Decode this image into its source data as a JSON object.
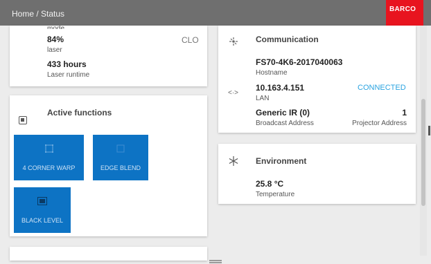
{
  "header": {
    "breadcrumb": "Home / Status",
    "brand": "BARCO",
    "brand_color": "#e8141f",
    "bar_color": "#6f6f6f"
  },
  "laser_card": {
    "value": "84%",
    "value_label": "laser",
    "runtime": "433 hours",
    "runtime_label": "Laser runtime",
    "mode_abbrev": "CLO"
  },
  "functions_card": {
    "title": "Active functions",
    "icon": "functions-icon",
    "tile_color": "#0d73c4",
    "tiles": [
      {
        "label": "4 CORNER WARP",
        "icon": "warp-icon"
      },
      {
        "label": "EDGE BLEND",
        "icon": "blend-icon"
      },
      {
        "label": "BLACK LEVEL",
        "icon": "black-level-icon"
      }
    ]
  },
  "communication_card": {
    "title": "Communication",
    "icon": "network-icon",
    "hostname": "FS70-4K6-2017040063",
    "hostname_label": "Hostname",
    "lan_icon": "lan-icon",
    "ip": "10.163.4.151",
    "ip_label": "LAN",
    "status": "CONNECTED",
    "status_color": "#2aa3e0",
    "ir_value": "Generic IR (0)",
    "ir_label": "Broadcast Address",
    "projector_value": "1",
    "projector_label": "Projector Address"
  },
  "environment_card": {
    "title": "Environment",
    "icon": "snowflake-icon",
    "temperature": "25.8 °C",
    "temperature_label": "Temperature"
  }
}
